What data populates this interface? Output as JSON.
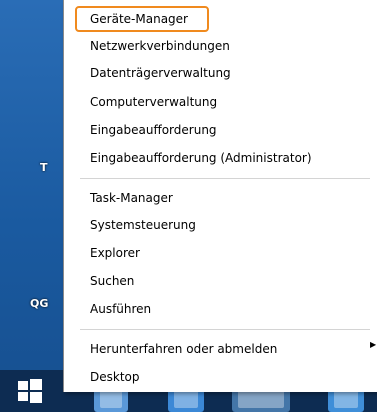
{
  "desktop": {
    "labels": [
      "T",
      "QG"
    ]
  },
  "menu": {
    "group1": [
      {
        "label": "Geräte-Manager",
        "highlighted": true
      },
      {
        "label": "Netzwerkverbindungen"
      },
      {
        "label": "Datenträgerverwaltung"
      },
      {
        "label": "Computerverwaltung"
      },
      {
        "label": "Eingabeaufforderung"
      },
      {
        "label": "Eingabeaufforderung (Administrator)"
      }
    ],
    "group2": [
      {
        "label": "Task-Manager"
      },
      {
        "label": "Systemsteuerung"
      },
      {
        "label": "Explorer"
      },
      {
        "label": "Suchen"
      },
      {
        "label": "Ausführen"
      }
    ],
    "group3": [
      {
        "label": "Herunterfahren oder abmelden",
        "has_submenu": true
      },
      {
        "label": "Desktop"
      }
    ],
    "submenu_icon": "chevron-right-icon",
    "highlight_color": "#f08a1e"
  },
  "taskbar": {
    "start_icon": "windows-logo-icon"
  }
}
